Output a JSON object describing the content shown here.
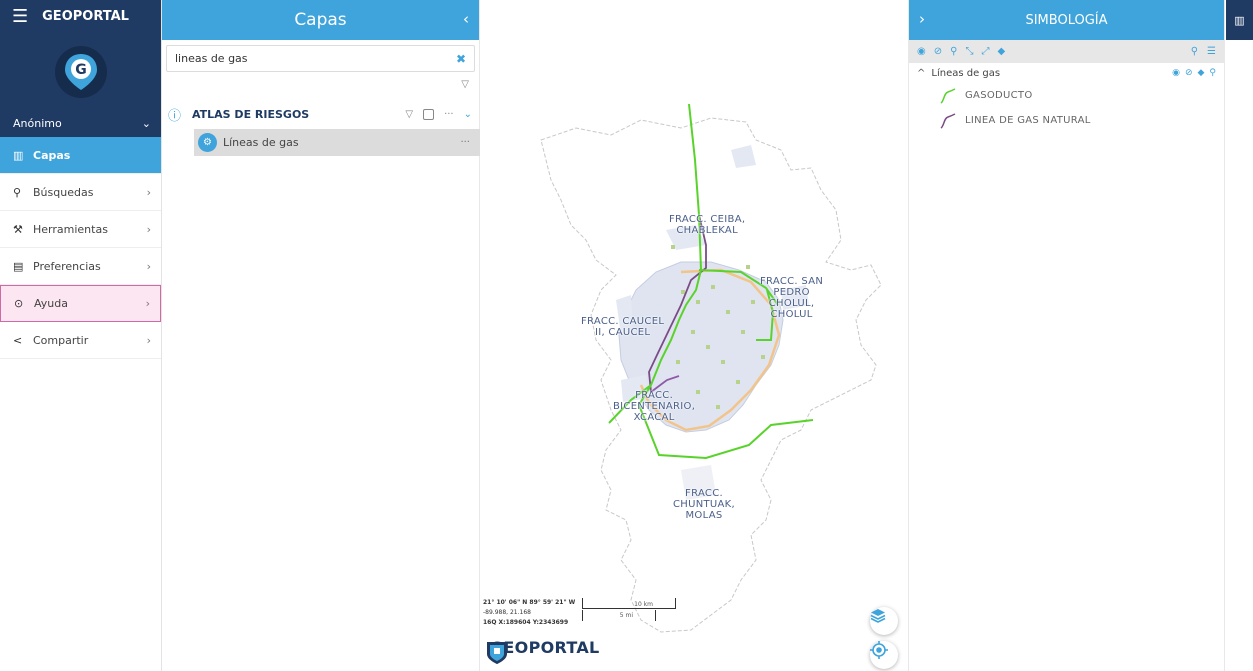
{
  "app": {
    "title": "GEOPORTAL"
  },
  "nav": {
    "user": "Anónimo",
    "items": [
      {
        "label": "Capas",
        "icon": "map-icon"
      },
      {
        "label": "Búsquedas",
        "icon": "search-icon"
      },
      {
        "label": "Herramientas",
        "icon": "tools-icon"
      },
      {
        "label": "Preferencias",
        "icon": "clipboard-icon"
      },
      {
        "label": "Ayuda",
        "icon": "help-icon"
      },
      {
        "label": "Compartir",
        "icon": "share-icon"
      }
    ]
  },
  "layers": {
    "title": "Capas",
    "search_value": "lineas de gas",
    "group": {
      "name": "ATLAS DE RIESGOS"
    },
    "layer": {
      "name": "Líneas de gas"
    }
  },
  "map": {
    "labels": {
      "ceiba": "FRACC. CEIBA,\nCHABLEKAL",
      "sanpedro": "FRACC. SAN\nPEDRO\nCHOLUL,\nCHOLUL",
      "caucel": "FRACC. CAUCEL\nII, CAUCEL",
      "bicentenario": "FRACC.\nBICENTENARIO,\nXCACAL",
      "chuntuak": "FRACC.\nCHUNTUAK,\nMOLAS"
    },
    "coords": {
      "dms": "21° 10' 06\" N 89° 59' 21\" W",
      "decimal": "-89.988, 21.168",
      "utm": "16Q X:189604 Y:2343699"
    },
    "scale": {
      "km": "10 km",
      "mi": "5 mi"
    },
    "brand": "GEOPORTAL"
  },
  "legend": {
    "title": "SIMBOLOGÍA",
    "layer_title": "Líneas de gas",
    "items": [
      {
        "label": "GASODUCTO",
        "color": "#59d32b"
      },
      {
        "label": "LINEA DE GAS NATURAL",
        "color": "#7a4c86"
      }
    ]
  },
  "colors": {
    "header_dark": "#1f3a63",
    "accent": "#3fa4db",
    "highlight": "#fce6f1",
    "gas_green": "#59d32b",
    "gas_purple": "#7a4c86",
    "ring_orange": "#f2c48a"
  }
}
